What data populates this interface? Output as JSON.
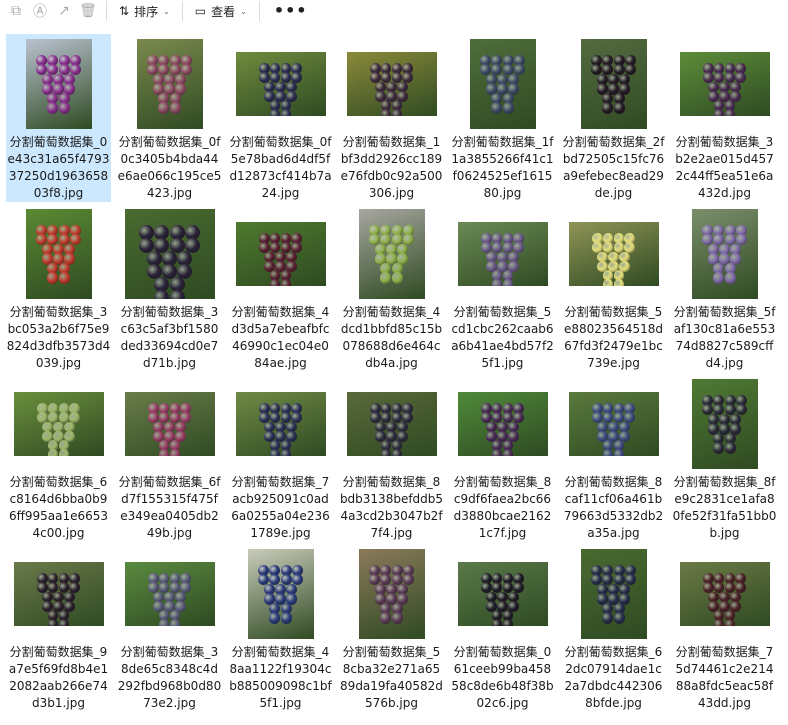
{
  "toolbar": {
    "sort_label": "排序",
    "view_label": "查看",
    "more_label": "•••"
  },
  "files": [
    {
      "name": "分割葡萄数据集_0e43c31a65f479337250d196365803f8.jpg",
      "orient": "portrait",
      "bg": "#b9c2cf",
      "grape": "#8a2f8f"
    },
    {
      "name": "分割葡萄数据集_0f0c3405b4bda44e6ae066c195ce5423.jpg",
      "orient": "portrait",
      "bg": "#7b8a4e",
      "grape": "#8e4a63"
    },
    {
      "name": "分割葡萄数据集_0f5e78bad6d4df5fd12873cf414b7a24.jpg",
      "orient": "landscape",
      "bg": "#6f8b3e",
      "grape": "#2b2c52"
    },
    {
      "name": "分割葡萄数据集_1bf3dd2926cc189e76fdb0c92a500306.jpg",
      "orient": "landscape",
      "bg": "#8a8a3a",
      "grape": "#3d2a3d"
    },
    {
      "name": "分割葡萄数据集_1f1a3855266f41c1f0624525ef161580.jpg",
      "orient": "portrait",
      "bg": "#4f6e3b",
      "grape": "#3d4a66"
    },
    {
      "name": "分割葡萄数据集_2fbd72505c15fc76a9efebec8ead29de.jpg",
      "orient": "portrait",
      "bg": "#546b3f",
      "grape": "#231a23"
    },
    {
      "name": "分割葡萄数据集_3b2e2ae015d4572c44ff5ea51e6a432d.jpg",
      "orient": "landscape",
      "bg": "#5c8d3a",
      "grape": "#4a2a52"
    },
    {
      "name": "分割葡萄数据集_3bc053a2b6f75e9824d3dfb3573d4039.jpg",
      "orient": "portrait",
      "bg": "#5a8a33",
      "grape": "#c23b2e"
    },
    {
      "name": "分割葡萄数据集_3c63c5af3bf1580ded33694cd0e7d71b.jpg",
      "orient": "square",
      "bg": "#4a6b30",
      "grape": "#2a2238"
    },
    {
      "name": "分割葡萄数据集_4d3d5a7ebeafbfc46990c1ec04e084ae.jpg",
      "orient": "landscape",
      "bg": "#4e7a2e",
      "grape": "#5a1f33"
    },
    {
      "name": "分割葡萄数据集_4dcd1bbfd85c15b078688d6e464cdb4a.jpg",
      "orient": "portrait",
      "bg": "#a7a7a0",
      "grape": "#8fb24a"
    },
    {
      "name": "分割葡萄数据集_5cd1cbc262caab6a6b41ae4bd57f25f1.jpg",
      "orient": "landscape",
      "bg": "#6b8a55",
      "grape": "#6b5a8a"
    },
    {
      "name": "分割葡萄数据集_5e88023564518d67fd3f2479e1bc739e.jpg",
      "orient": "landscape",
      "bg": "#8f9456",
      "grape": "#e5e07a"
    },
    {
      "name": "分割葡萄数据集_5faf130c81a6e55374d8827c589cffd4.jpg",
      "orient": "portrait",
      "bg": "#7a8e6a",
      "grape": "#7f6aa8"
    },
    {
      "name": "分割葡萄数据集_6c8164d6bba0b96ff995aa1e66534c00.jpg",
      "orient": "landscape",
      "bg": "#6b8f3d",
      "grape": "#9fb86a"
    },
    {
      "name": "分割葡萄数据集_6fd7f155315f475fe349ea0405db249b.jpg",
      "orient": "landscape",
      "bg": "#6a7d4a",
      "grape": "#9a3d66"
    },
    {
      "name": "分割葡萄数据集_7acb925091c0ad6a0255a04e2361789e.jpg",
      "orient": "landscape",
      "bg": "#6f8a45",
      "grape": "#2a2f55"
    },
    {
      "name": "分割葡萄数据集_8bdb3138befddb54a3cd2b3047b2f7f4.jpg",
      "orient": "landscape",
      "bg": "#5a6a3a",
      "grape": "#2e2a3e"
    },
    {
      "name": "分割葡萄数据集_8c9df6faea2bc66d3880bcae21621c7f.jpg",
      "orient": "landscape",
      "bg": "#4f8a3a",
      "grape": "#4a2a55"
    },
    {
      "name": "分割葡萄数据集_8caf11cf06a461b79663d5332db2a35a.jpg",
      "orient": "landscape",
      "bg": "#5a7a3e",
      "grape": "#3d4a80"
    },
    {
      "name": "分割葡萄数据集_8fe9c2831ce1afa80fe52f31fa51bb0b.jpg",
      "orient": "portrait",
      "bg": "#4f7a33",
      "grape": "#2a2a38"
    },
    {
      "name": "分割葡萄数据集_9a7e5f69fd8b4e12082aab266e74d3b1.jpg",
      "orient": "landscape",
      "bg": "#6a7a4a",
      "grape": "#2a1f2a"
    },
    {
      "name": "分割葡萄数据集_38de65c8348c4d292fbd968b0d8073e2.jpg",
      "orient": "landscape",
      "bg": "#5a8a40",
      "grape": "#5a5a7a"
    },
    {
      "name": "分割葡萄数据集_48aa1122f19304cb885009098c1bf5f1.jpg",
      "orient": "portrait",
      "bg": "#c9ccbb",
      "grape": "#2a3a7a"
    },
    {
      "name": "分割葡萄数据集_58cba32e271a6589da19fa40582d576b.jpg",
      "orient": "portrait",
      "bg": "#8a7a5a",
      "grape": "#5a3a55"
    },
    {
      "name": "分割葡萄数据集_061ceeb99ba45858c8de6b48f38b02c6.jpg",
      "orient": "landscape",
      "bg": "#5a7a4a",
      "grape": "#1f1a25"
    },
    {
      "name": "分割葡萄数据集_62dc07914dae1c2a7dbdc4423068bfde.jpg",
      "orient": "portrait",
      "bg": "#4a6a30",
      "grape": "#262c4a"
    },
    {
      "name": "分割葡萄数据集_75d74461c2e21488a8fdc5eac58f43dd.jpg",
      "orient": "landscape",
      "bg": "#6b7a45",
      "grape": "#4a2025"
    }
  ]
}
